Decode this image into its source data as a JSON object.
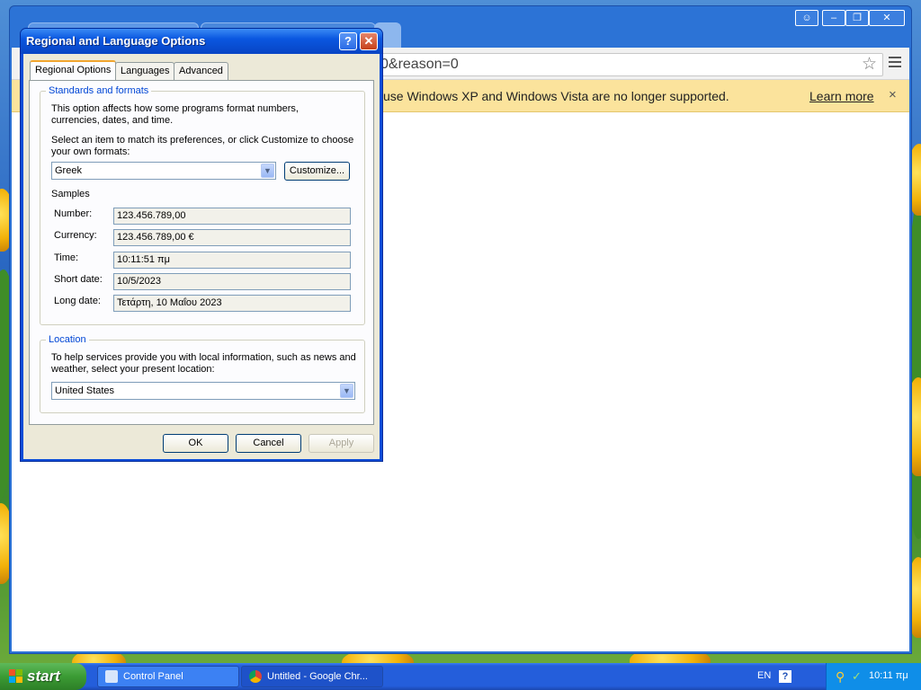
{
  "chrome": {
    "address_text": "0&reason=0",
    "infobar_message": "use Windows XP and Windows Vista are no longer supported.",
    "infobar_link": "Learn more",
    "infobar_close": "×"
  },
  "dialog": {
    "title": "Regional and Language Options",
    "help_symbol": "?",
    "close_symbol": "✕",
    "tabs": [
      "Regional Options",
      "Languages",
      "Advanced"
    ],
    "standards": {
      "legend": "Standards and formats",
      "description": "This option affects how some programs format numbers, currencies, dates, and time.",
      "prompt": "Select an item to match its preferences, or click Customize to choose your own formats:",
      "selected_format": "Greek",
      "customize_label": "Customize...",
      "samples_heading": "Samples",
      "samples": [
        {
          "label": "Number:",
          "value": "123.456.789,00"
        },
        {
          "label": "Currency:",
          "value": "123.456.789,00 €"
        },
        {
          "label": "Time:",
          "value": "10:11:51 πμ"
        },
        {
          "label": "Short date:",
          "value": "10/5/2023"
        },
        {
          "label": "Long date:",
          "value": "Τετάρτη, 10 Μαΐου 2023"
        }
      ]
    },
    "location": {
      "legend": "Location",
      "description": "To help services provide you with local information, such as news and weather, select your present location:",
      "selected": "United States"
    },
    "buttons": {
      "ok": "OK",
      "cancel": "Cancel",
      "apply": "Apply"
    }
  },
  "taskbar": {
    "start_label": "start",
    "items": [
      "Control Panel",
      "Untitled - Google Chr..."
    ],
    "language": "EN",
    "help_symbol": "?",
    "clock": "10:11 πμ"
  },
  "colors": {
    "xp_blue": "#0a4dd8",
    "dialog_face": "#ece9d8",
    "infobar": "#fbe39c",
    "start_green": "#3b9b34"
  }
}
